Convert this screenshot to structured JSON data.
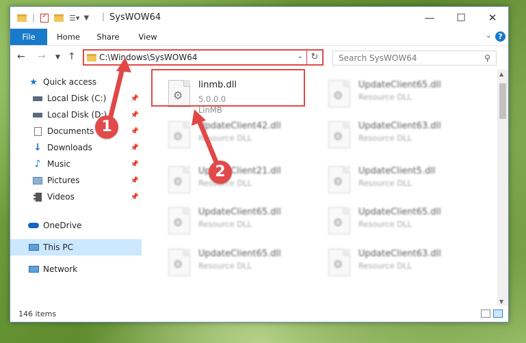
{
  "window": {
    "title": "SysWOW64",
    "controls": {
      "minimize": "—",
      "maximize": "☐",
      "close": "✕"
    }
  },
  "ribbon": {
    "tabs": [
      "File",
      "Home",
      "Share",
      "View"
    ],
    "help": "?"
  },
  "navbar": {
    "address": "C:\\Windows\\SysWOW64",
    "search_placeholder": "Search SysWOW64"
  },
  "sidebar": {
    "items": [
      {
        "label": "Quick access",
        "icon": "star-icon"
      },
      {
        "label": "Local Disk (C:)",
        "icon": "drive-icon",
        "pinned": true
      },
      {
        "label": "Local Disk (D:)",
        "icon": "drive-icon",
        "pinned": true
      },
      {
        "label": "Documents",
        "icon": "documents-icon",
        "pinned": true
      },
      {
        "label": "Downloads",
        "icon": "downloads-icon",
        "pinned": true
      },
      {
        "label": "Music",
        "icon": "music-icon",
        "pinned": true
      },
      {
        "label": "Pictures",
        "icon": "pictures-icon",
        "pinned": true
      },
      {
        "label": "Videos",
        "icon": "videos-icon",
        "pinned": true
      },
      {
        "label": "OneDrive",
        "icon": "cloud-icon"
      },
      {
        "label": "This PC",
        "icon": "computer-icon",
        "selected": true
      },
      {
        "label": "Network",
        "icon": "network-icon"
      }
    ]
  },
  "files": [
    {
      "name": "linmb.dll",
      "line2": "5.0.0.0",
      "line3": "LinMB"
    },
    {
      "name": "UpdateClient65.dll",
      "line2": "Resource DLL"
    },
    {
      "name": "UpdateClient42.dll",
      "line2": "Resource DLL"
    },
    {
      "name": "UpdateClient63.dll",
      "line2": "Resource DLL"
    },
    {
      "name": "UpdateClient21.dll",
      "line2": "Resource DLL"
    },
    {
      "name": "UpdateClient5.dll",
      "line2": "Resource DLL"
    },
    {
      "name": "UpdateClient65.dll",
      "line2": "Resource DLL"
    },
    {
      "name": "UpdateClient65.dll",
      "line2": "Resource DLL"
    },
    {
      "name": "UpdateClient65.dll",
      "line2": "Resource DLL"
    },
    {
      "name": "UpdateClient63.dll",
      "line2": "Resource DLL"
    }
  ],
  "status": {
    "count": "146 items"
  },
  "annotations": {
    "marker1": "1",
    "marker2": "2",
    "color": "#e04848"
  }
}
